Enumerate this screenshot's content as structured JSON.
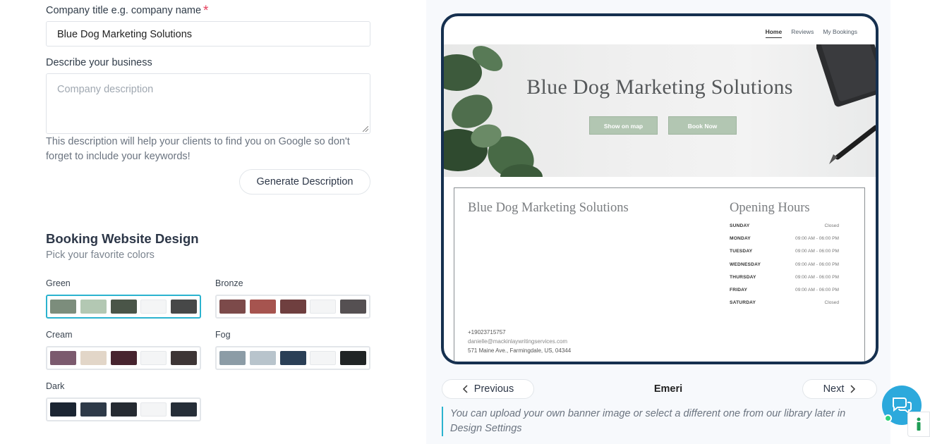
{
  "form": {
    "title_label": "Company title e.g. company name",
    "required_mark": "*",
    "title_value": "Blue Dog Marketing Solutions",
    "desc_label": "Describe your business",
    "desc_placeholder": "Company description",
    "help_text": "This description will help your clients to find you on Google so don't forget to include your keywords!",
    "generate_label": "Generate Description"
  },
  "design": {
    "title": "Booking Website Design",
    "subtitle": "Pick your favorite colors",
    "palettes": [
      {
        "name": "Green",
        "colors": [
          "#7c8d7c",
          "#b3c8b3",
          "#4a5548",
          "#f4f5f6",
          "#474848"
        ],
        "selected": true
      },
      {
        "name": "Bronze",
        "colors": [
          "#7c4a4a",
          "#a6544f",
          "#6f3f3f",
          "#f4f5f6",
          "#555052"
        ],
        "selected": false
      },
      {
        "name": "Cream",
        "colors": [
          "#7b5a6e",
          "#e2d6c8",
          "#47242f",
          "#f4f5f6",
          "#3d3535"
        ],
        "selected": false
      },
      {
        "name": "Fog",
        "colors": [
          "#8c9ca6",
          "#b8c4cc",
          "#2a3f56",
          "#f4f5f6",
          "#202425"
        ],
        "selected": false
      },
      {
        "name": "Dark",
        "colors": [
          "#1b2532",
          "#2e3a48",
          "#262b32",
          "#f4f5f6",
          "#262e38"
        ],
        "selected": false
      }
    ]
  },
  "preview": {
    "nav": [
      "Home",
      "Reviews",
      "My Bookings"
    ],
    "banner_title": "Blue Dog Marketing Solutions",
    "show_on_map": "Show on map",
    "book_now": "Book Now",
    "company_name": "Blue Dog Marketing Solutions",
    "hours_title": "Opening Hours",
    "hours": [
      {
        "day": "SUNDAY",
        "time": "Closed"
      },
      {
        "day": "MONDAY",
        "time": "09:00 AM - 06:00 PM"
      },
      {
        "day": "TUESDAY",
        "time": "09:00 AM - 06:00 PM"
      },
      {
        "day": "WEDNESDAY",
        "time": "09:00 AM - 06:00 PM"
      },
      {
        "day": "THURSDAY",
        "time": "09:00 AM - 06:00 PM"
      },
      {
        "day": "FRIDAY",
        "time": "09:00 AM - 06:00 PM"
      },
      {
        "day": "SATURDAY",
        "time": "Closed"
      }
    ],
    "phone": "+19023715757",
    "email": "danielle@mackinlaywritingservices.com",
    "address": "571 Maine Ave., Farmingdale, US, 04344"
  },
  "theme_nav": {
    "previous": "Previous",
    "theme_name": "Emeri",
    "next": "Next",
    "note": "You can upload your own banner image or select a different one from our library later in Design Settings"
  }
}
